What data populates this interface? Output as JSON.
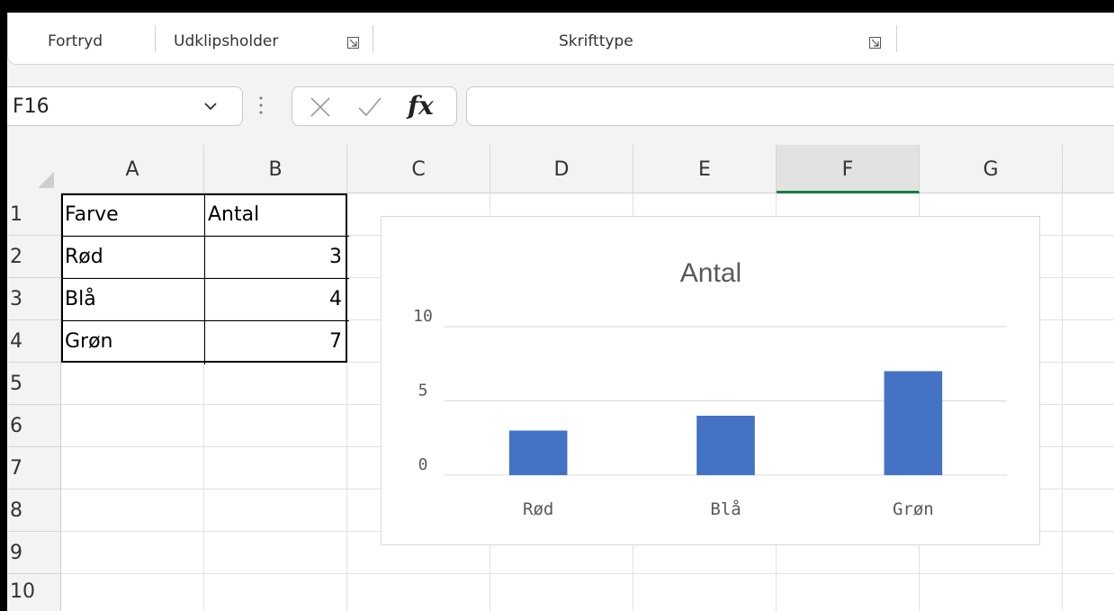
{
  "ribbon": {
    "groups": [
      {
        "label": "Fortryd",
        "has_launcher": false
      },
      {
        "label": "Udklipsholder",
        "has_launcher": true
      },
      {
        "label": "Skrifttype",
        "has_launcher": true
      }
    ]
  },
  "formula_bar": {
    "name_box": "F16",
    "fx_label": "fx",
    "formula": ""
  },
  "grid": {
    "columns": [
      "A",
      "B",
      "C",
      "D",
      "E",
      "F",
      "G"
    ],
    "selected_column": "F",
    "rows": [
      "1",
      "2",
      "3",
      "4",
      "5",
      "6",
      "7",
      "8",
      "9",
      "10"
    ],
    "cells": {
      "A1": "Farve",
      "B1": "Antal",
      "A2": "Rød",
      "B2": "3",
      "A3": "Blå",
      "B3": "4",
      "A4": "Grøn",
      "B4": "7"
    }
  },
  "chart_data": {
    "type": "bar",
    "title": "Antal",
    "categories": [
      "Rød",
      "Blå",
      "Grøn"
    ],
    "values": [
      3,
      4,
      7
    ],
    "ylim": [
      0,
      10
    ],
    "yticks": [
      0,
      5,
      10
    ],
    "grid": true,
    "legend": "none",
    "bar_color": "#4472c4"
  },
  "colors": {
    "selected_column_underline": "#137e43",
    "bar": "#4472c4"
  }
}
